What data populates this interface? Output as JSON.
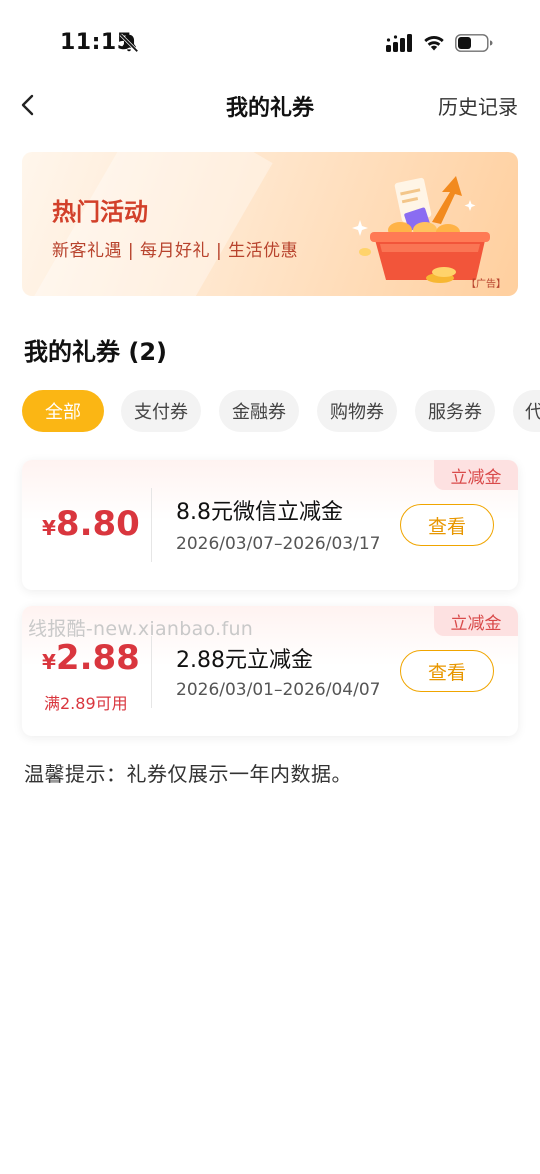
{
  "status_bar": {
    "time": "11:15"
  },
  "nav": {
    "title": "我的礼券",
    "history": "历史记录"
  },
  "banner": {
    "title": "热门活动",
    "subtitle": "新客礼遇 | 每月好礼 | 生活优惠",
    "ad_label": "【广告】"
  },
  "section": {
    "title": "我的礼券 (2)"
  },
  "chips": [
    "全部",
    "支付券",
    "金融券",
    "购物券",
    "服务券",
    "代"
  ],
  "coupons": [
    {
      "currency": "¥",
      "amount": "8.80",
      "name": "8.8元微信立减金",
      "dates": "2026/03/07–2026/03/17",
      "tag": "立减金",
      "button": "查看"
    },
    {
      "currency": "¥",
      "amount": "2.88",
      "condition": "满2.89可用",
      "name": "2.88元立减金",
      "dates": "2026/03/01–2026/04/07",
      "tag": "立减金",
      "button": "查看"
    }
  ],
  "watermark": "线报酷-new.xianbao.fun",
  "tip": "温馨提示：礼券仅展示一年内数据。",
  "colors": {
    "accent": "#fbb614",
    "price": "#d9363e",
    "tag_bg": "#fde1e1"
  },
  "icons": [
    "bell-off-icon",
    "signal-icon",
    "wifi-icon",
    "battery-icon",
    "back-arrow-icon",
    "gift-basket-illustration"
  ]
}
